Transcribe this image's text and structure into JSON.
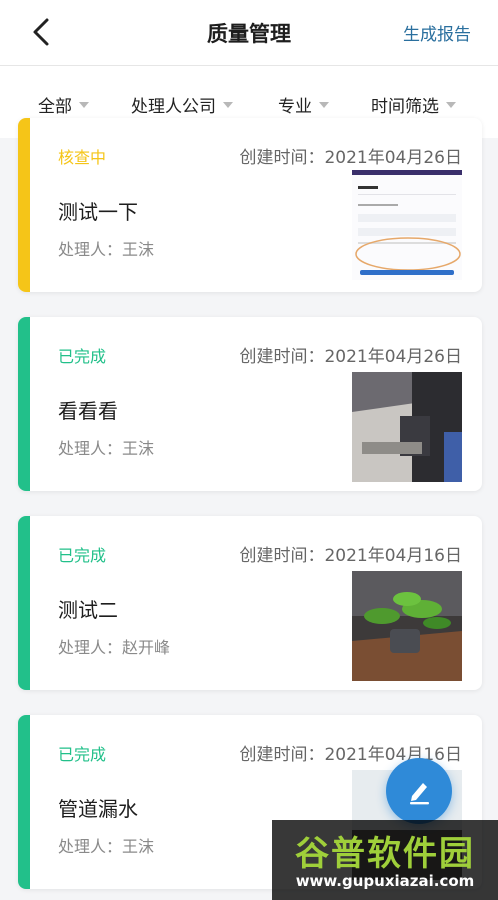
{
  "header": {
    "title": "质量管理",
    "action_label": "生成报告",
    "back_icon": "chevron-left-icon"
  },
  "filters": [
    {
      "label": "全部"
    },
    {
      "label": "处理人公司"
    },
    {
      "label": "专业"
    },
    {
      "label": "时间筛选"
    }
  ],
  "status_colors": {
    "checking": "#f5c518",
    "done": "#22c08a"
  },
  "cards": [
    {
      "status": "核查中",
      "status_key": "checking",
      "date": "创建时间：2021年04月26日",
      "title": "测试一下",
      "handler": "处理人：王沫",
      "thumb": "screenshot-thumbnail"
    },
    {
      "status": "已完成",
      "status_key": "done",
      "date": "创建时间：2021年04月26日",
      "title": "看看看",
      "handler": "处理人：王沫",
      "thumb": "office-photo-thumbnail"
    },
    {
      "status": "已完成",
      "status_key": "done",
      "date": "创建时间：2021年04月16日",
      "title": "测试二",
      "handler": "处理人：赵开峰",
      "thumb": "plant-photo-thumbnail"
    },
    {
      "status": "已完成",
      "status_key": "done",
      "date": "创建时间：2021年04月16日",
      "title": "管道漏水",
      "handler": "处理人：王沫",
      "thumb": "photo-thumbnail"
    }
  ],
  "fab": {
    "icon": "edit-pen-icon"
  },
  "watermark": {
    "brand": "谷普软件园",
    "url": "www.gupuxiazai.com"
  }
}
